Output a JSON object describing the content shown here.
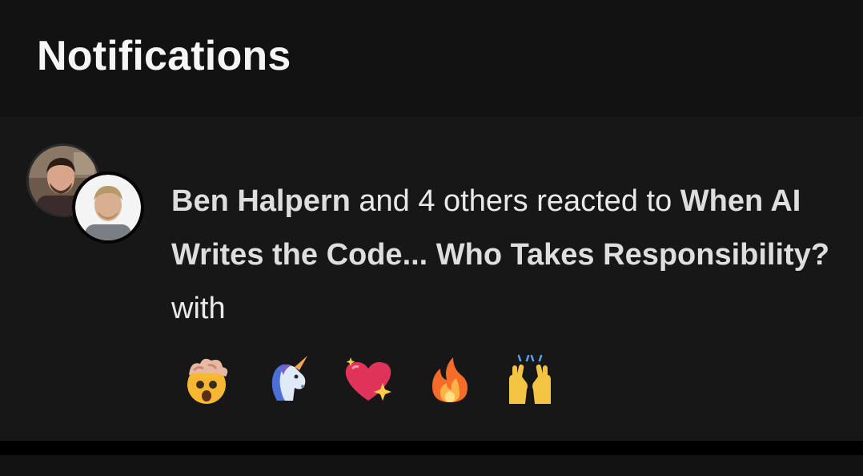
{
  "header": {
    "title": "Notifications"
  },
  "notification": {
    "actor": "Ben Halpern",
    "others_text": " and 4 others reacted to ",
    "article_title": "When AI Writes the Code... Who Takes Responsibility?",
    "suffix_text": " with",
    "reactions": [
      {
        "icon": "exploding-head-icon"
      },
      {
        "icon": "unicorn-icon"
      },
      {
        "icon": "sparkling-heart-icon"
      },
      {
        "icon": "fire-icon"
      },
      {
        "icon": "raising-hands-icon"
      }
    ]
  },
  "colors": {
    "background": "#0b0b0b",
    "header_bg": "#121212",
    "card_bg": "#171717",
    "text": "#e9e9e9"
  }
}
